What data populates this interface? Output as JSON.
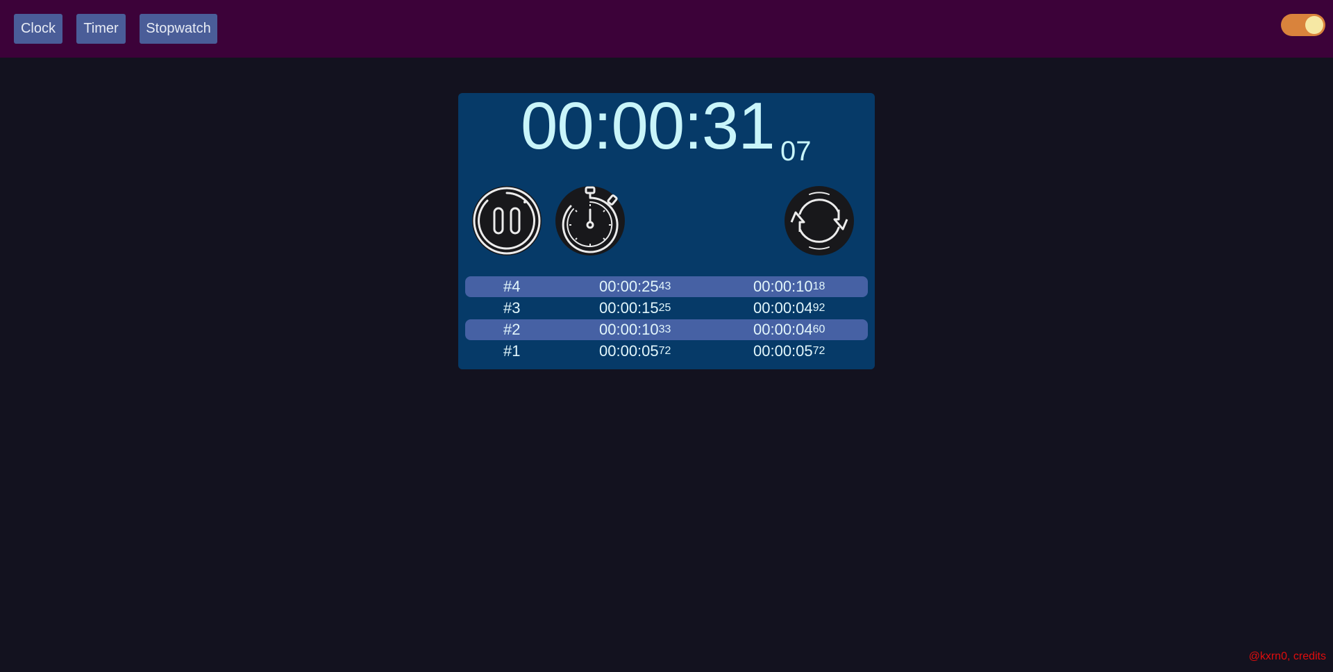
{
  "nav": {
    "clock_label": "Clock",
    "timer_label": "Timer",
    "stopwatch_label": "Stopwatch"
  },
  "theme_toggle": {
    "state": "on",
    "track_color": "#d9833c",
    "knob_color": "#f6e8a4"
  },
  "stopwatch": {
    "time": "00:00:31",
    "centiseconds": "07"
  },
  "controls": {
    "pause_icon": "pause-icon",
    "lap_icon": "stopwatch-icon",
    "reset_icon": "refresh-icon"
  },
  "laps": [
    {
      "num": "#4",
      "total": "00:00:25",
      "total_cs": "43",
      "split": "00:00:10",
      "split_cs": "18"
    },
    {
      "num": "#3",
      "total": "00:00:15",
      "total_cs": "25",
      "split": "00:00:04",
      "split_cs": "92"
    },
    {
      "num": "#2",
      "total": "00:00:10",
      "total_cs": "33",
      "split": "00:00:04",
      "split_cs": "60"
    },
    {
      "num": "#1",
      "total": "00:00:05",
      "total_cs": "72",
      "split": "00:00:05",
      "split_cs": "72"
    }
  ],
  "credits": "@kxrn0, credits",
  "colors": {
    "header_bg": "#3c0239",
    "page_bg": "#13121f",
    "card_bg": "#063a68",
    "button_bg": "#4a5d98",
    "lap_highlight": "#4661a4",
    "time_text": "#c9f5fa",
    "credits_text": "#e00d0d"
  }
}
